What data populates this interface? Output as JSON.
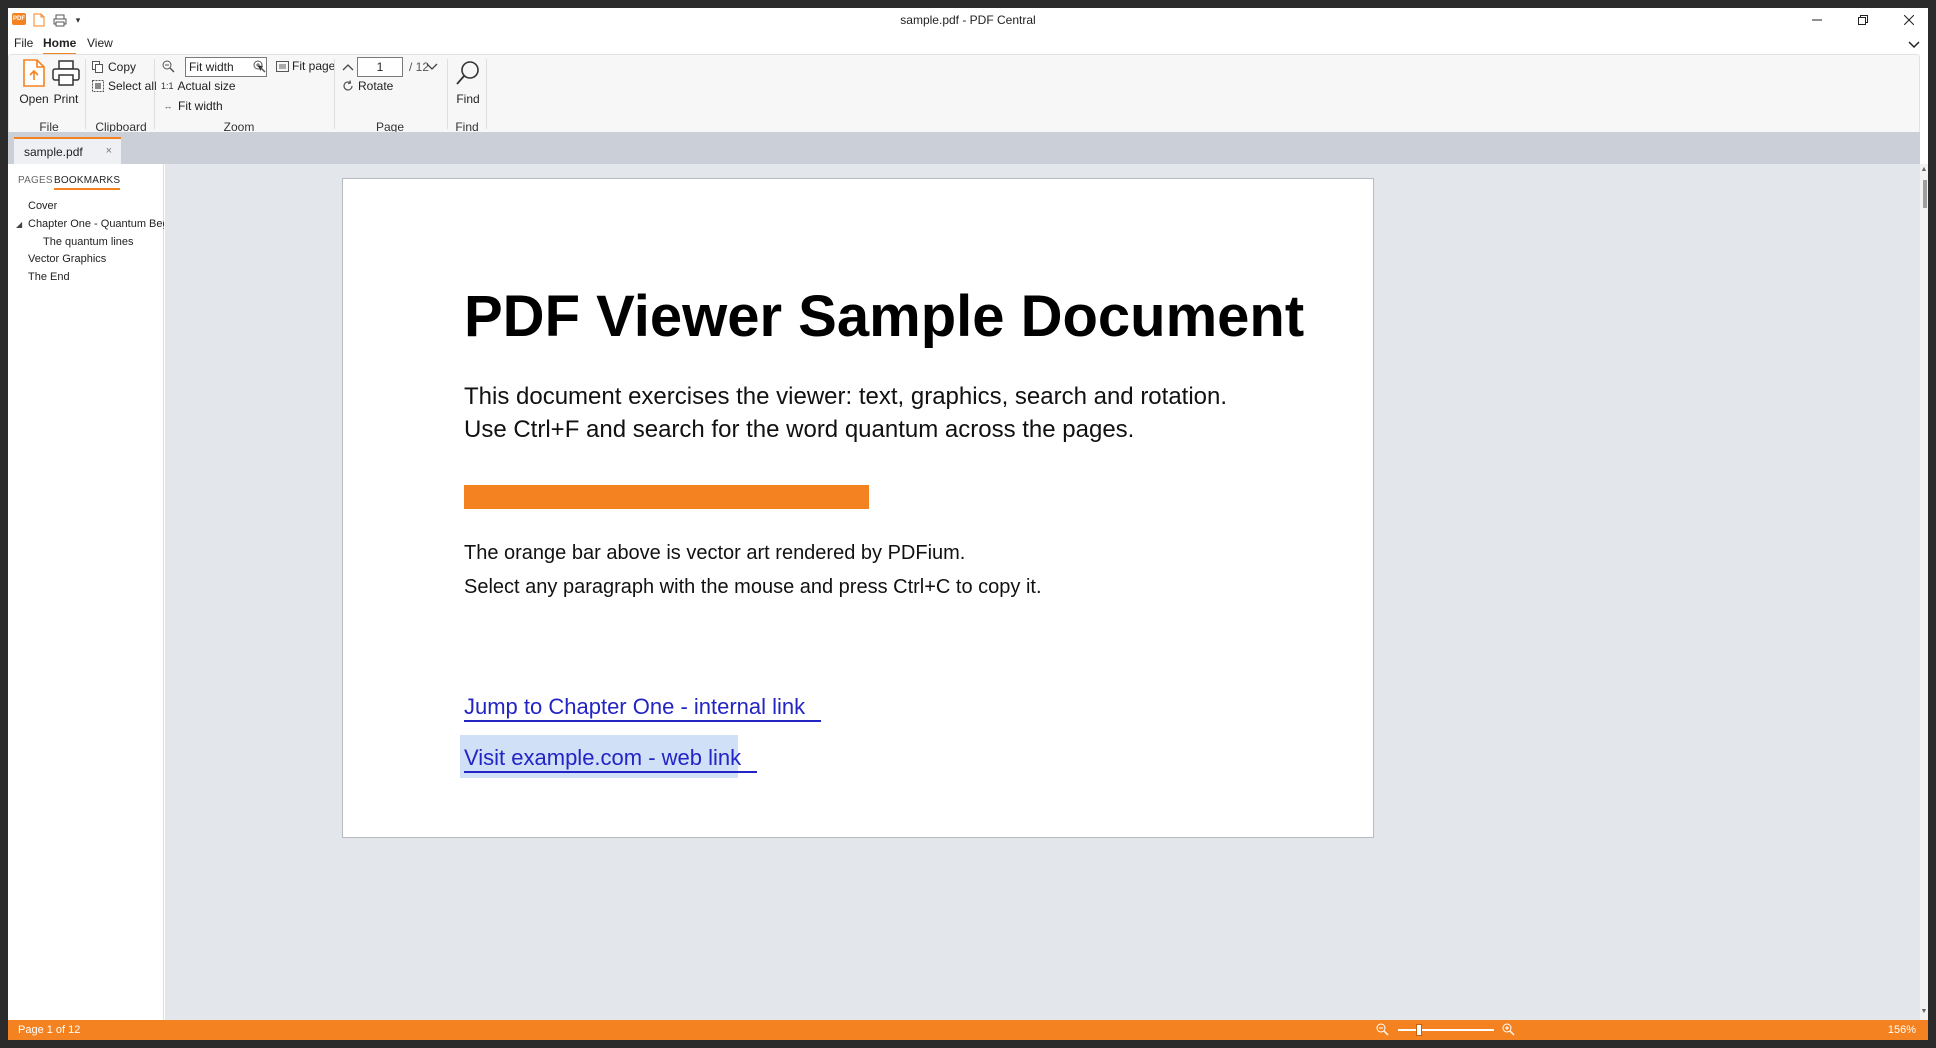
{
  "window": {
    "title": "sample.pdf - PDF Central",
    "logo_text": "PDF"
  },
  "menu": {
    "items": [
      "File",
      "Home",
      "View"
    ],
    "active": "Home"
  },
  "ribbon": {
    "file": {
      "open_label": "Open",
      "print_label": "Print",
      "group_label": "File"
    },
    "clipboard": {
      "copy_label": "Copy",
      "select_all_label": "Select all",
      "group_label": "Clipboard"
    },
    "zoom": {
      "select_value": "Fit width",
      "fit_page_label": "Fit page",
      "actual_size_prefix": "1:1",
      "actual_size_label": "Actual size",
      "fit_width_label": "Fit width",
      "group_label": "Zoom"
    },
    "page": {
      "current": "1",
      "total_text": "/ 12",
      "rotate_label": "Rotate",
      "group_label": "Page"
    },
    "find": {
      "find_label": "Find",
      "group_label": "Find"
    }
  },
  "tabs": [
    {
      "label": "sample.pdf",
      "close": "×"
    }
  ],
  "sidebar": {
    "tabs": [
      "PAGES",
      "BOOKMARKS"
    ],
    "active_tab": "BOOKMARKS",
    "bookmarks": [
      {
        "label": "Cover",
        "level": 0
      },
      {
        "label": "Chapter One - Quantum Beginn",
        "level": 0,
        "expanded": true
      },
      {
        "label": "The quantum lines",
        "level": 1
      },
      {
        "label": "Vector Graphics",
        "level": 0
      },
      {
        "label": "The End",
        "level": 0
      }
    ]
  },
  "document": {
    "title": "PDF Viewer Sample Document",
    "intro_line1": "This document exercises the viewer: text, graphics, search and rotation.",
    "intro_line2": "Use Ctrl+F and search for the word quantum across the pages.",
    "bar_color": "#f58220",
    "body_line1": "The orange bar above is vector art rendered by PDFium.",
    "body_line2": "Select any paragraph with the mouse and press Ctrl+C to copy it.",
    "link_internal": "Jump to Chapter One - internal link",
    "link_web": "Visit example.com - web link"
  },
  "status": {
    "page_text": "Page 1 of 12",
    "zoom_text": "156%",
    "zoom_level_fraction": 0.22
  },
  "colors": {
    "accent": "#f58220",
    "link": "#2224c4",
    "tabstrip": "#cbd0d8"
  }
}
